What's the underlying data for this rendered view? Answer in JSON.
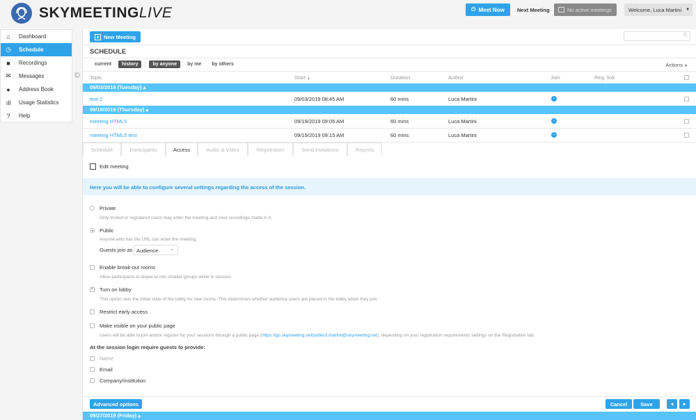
{
  "header": {
    "brand": "SKYMEETING",
    "brand_suffix": "LIVE",
    "meet_now": "Meet Now",
    "next_meeting_label": "Next Meeting",
    "no_active": "No active meetings",
    "welcome": "Welcome, Luca Martini"
  },
  "sidebar": {
    "items": [
      {
        "label": "Dashboard",
        "icon": "home-icon"
      },
      {
        "label": "Schedule",
        "icon": "clock-icon"
      },
      {
        "label": "Recordings",
        "icon": "camera-icon"
      },
      {
        "label": "Messages",
        "icon": "envelope-icon"
      },
      {
        "label": "Address Book",
        "icon": "user-icon"
      },
      {
        "label": "Usage Statistics",
        "icon": "bar-chart-icon"
      },
      {
        "label": "Help",
        "icon": "help-icon"
      }
    ]
  },
  "main": {
    "new_meeting": "New Meeting",
    "title": "SCHEDULE",
    "filters": {
      "current": "current",
      "history": "history",
      "by_anyone": "by anyone",
      "by_me": "by me",
      "by_others": "by others"
    },
    "actions": "Actions",
    "columns": {
      "topic": "Topic",
      "start": "Start",
      "duration": "Duration",
      "author": "Author",
      "join": "Join",
      "reg_link": "Reg. link"
    },
    "groups": [
      {
        "label": "09/03/2019 (Tuesday)",
        "rows": [
          {
            "topic": "test 2",
            "start": "09/03/2019 08:45 AM",
            "duration": "60 mins",
            "author": "Luca Martini"
          }
        ]
      },
      {
        "label": "09/19/2019 (Thursday)",
        "rows": [
          {
            "topic": "meeting HTML5",
            "start": "09/19/2019 09:05 AM",
            "duration": "60 mins",
            "author": "Luca Martini"
          },
          {
            "topic": "meeting HTML5 test",
            "start": "09/19/2019 09:15 AM",
            "duration": "60 mins",
            "author": "Luca Martini"
          }
        ]
      }
    ],
    "next_group": "09/27/2019 (Friday)"
  },
  "editor": {
    "tabs": [
      "Schedule",
      "Participants",
      "Access",
      "Audio & Video",
      "Registration",
      "Send invitations",
      "Reports"
    ],
    "active_tab": "Access",
    "edit_meeting": "Edit meeting",
    "info": "Here you will be able to configure several settings regarding the access of the session.",
    "private": "Private",
    "private_desc": "Only invited or registered users may enter the meeting and view recordings made in it.",
    "public": "Public",
    "public_desc": "Anyone who has the URL can enter the meeting.",
    "guests_join_as": "Guests join as",
    "guests_role": "Audience",
    "breakout": "Enable break-out rooms",
    "breakout_desc": "Allow participants to disperse into smaller groups while in session.",
    "lobby": "Turn on lobby",
    "lobby_desc": "This option sets the initial state of the lobby for new rooms. This determines whether audience users are placed in the lobby when they join.",
    "restrict": "Restrict early access",
    "visible": "Make visible on your public page",
    "visible_desc_pre": "Users will be able to join and/or register for your sessions through a public page (",
    "visible_link": "https://go.skymeeting.net/public/l.martini@skymeeting.net",
    "visible_desc_post": "), depending on your registration requirements settings on the Registration tab.",
    "require_title": "At the session login require guests to provide:",
    "req_name": "Name",
    "req_email": "Email",
    "req_company": "Company/Institution",
    "advanced": "Advanced options",
    "cancel": "Cancel",
    "save": "Save"
  }
}
